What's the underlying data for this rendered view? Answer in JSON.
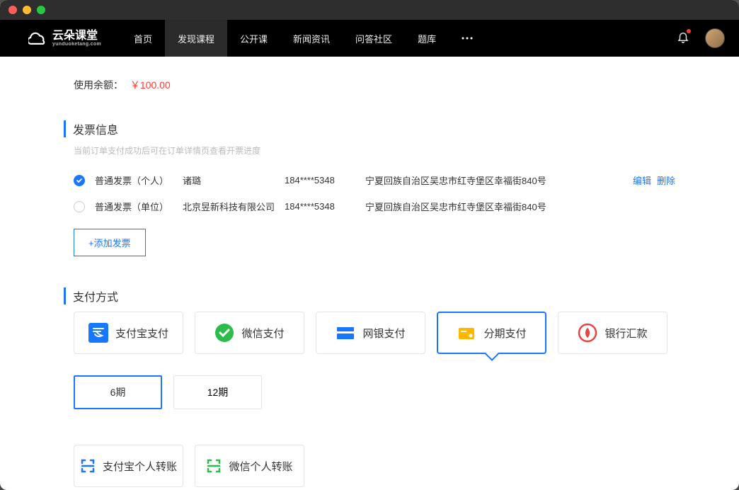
{
  "brand": {
    "name": "云朵课堂",
    "sub": "yunduoketang.com"
  },
  "nav": {
    "items": [
      {
        "label": "首页"
      },
      {
        "label": "发现课程",
        "active": true
      },
      {
        "label": "公开课"
      },
      {
        "label": "新闻资讯"
      },
      {
        "label": "问答社区"
      },
      {
        "label": "题库"
      }
    ]
  },
  "balance": {
    "label": "使用余额：",
    "amount": "￥100.00"
  },
  "invoice_section": {
    "title": "发票信息",
    "subtitle": "当前订单支付成功后可在订单详情页查看开票进度",
    "rows": [
      {
        "selected": true,
        "type": "普通发票（个人）",
        "name": "诸璐",
        "phone": "184****5348",
        "address": "宁夏回族自治区吴忠市红寺堡区幸福街840号",
        "actions": {
          "edit": "编辑",
          "delete": "删除"
        }
      },
      {
        "selected": false,
        "type": "普通发票（单位）",
        "name": "北京昱新科技有限公司",
        "phone": "184****5348",
        "address": "宁夏回族自治区吴忠市红寺堡区幸福街840号"
      }
    ],
    "add_button": "+添加发票"
  },
  "payment_section": {
    "title": "支付方式",
    "methods": [
      {
        "id": "alipay",
        "label": "支付宝支付"
      },
      {
        "id": "wechat",
        "label": "微信支付"
      },
      {
        "id": "unionpay",
        "label": "网银支付"
      },
      {
        "id": "installment",
        "label": "分期支付",
        "selected": true
      },
      {
        "id": "bank",
        "label": "银行汇款"
      }
    ],
    "periods": [
      {
        "label": "6期",
        "selected": true
      },
      {
        "label": "12期"
      }
    ],
    "transfers": [
      {
        "id": "alipay-personal",
        "label": "支付宝个人转账",
        "color": "#1977ff"
      },
      {
        "id": "wechat-personal",
        "label": "微信个人转账",
        "color": "#2bbd4b"
      }
    ]
  }
}
